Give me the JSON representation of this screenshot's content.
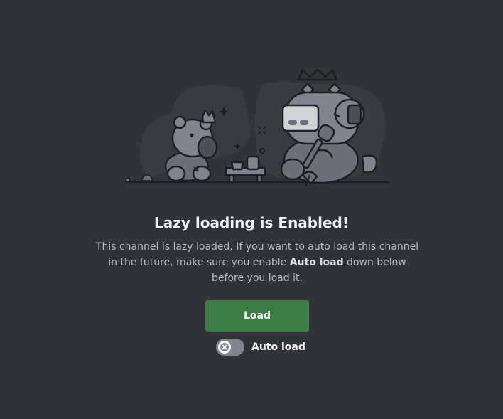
{
  "empty_state": {
    "title": "Lazy loading is Enabled!",
    "description_before": "This channel is lazy loaded, If you want to auto load this channel in the future, make sure you enable ",
    "description_emphasis": "Auto load",
    "description_after": " down below before you load it."
  },
  "actions": {
    "load_label": "Load",
    "auto_load_label": "Auto load",
    "auto_load_enabled": false
  },
  "icons": {
    "toggle_knob": "close-icon",
    "illustration": "bears-and-robot-illustration"
  },
  "colors": {
    "background": "#313338",
    "load_button": "#3b7d44",
    "toggle_off": "#80848e"
  }
}
